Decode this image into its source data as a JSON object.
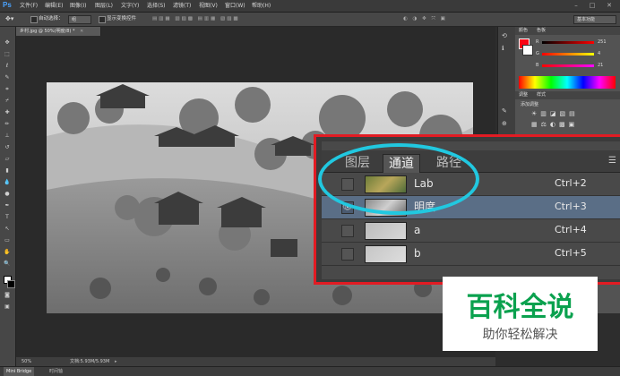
{
  "app": {
    "logo": "Ps"
  },
  "menu": [
    "文件(F)",
    "编辑(E)",
    "图像(I)",
    "图层(L)",
    "文字(Y)",
    "选择(S)",
    "滤镜(T)",
    "视图(V)",
    "窗口(W)",
    "帮助(H)"
  ],
  "options": {
    "auto_select_label": "自动选择：",
    "auto_select_value": "组",
    "show_transform_label": "显示变换控件",
    "workspace": "基本功能"
  },
  "document": {
    "tab_title": "乡村.jpg @ 50%(明度/8) *"
  },
  "status": {
    "zoom": "50%",
    "doc_size": "文档:5.93M/5.93M"
  },
  "bottom_tabs": [
    "Mini Bridge",
    "时间轴"
  ],
  "color_panel": {
    "tabs": [
      "颜色",
      "色板"
    ],
    "channels": [
      {
        "label": "R",
        "value": "251"
      },
      {
        "label": "G",
        "value": "4"
      },
      {
        "label": "B",
        "value": "21"
      }
    ]
  },
  "adjust_panel": {
    "tabs": [
      "调整",
      "样式"
    ],
    "title": "添加调整"
  },
  "channels_panel": {
    "tabs": [
      "图层",
      "通道",
      "路径"
    ],
    "active_tab": 1,
    "rows": [
      {
        "name": "Lab",
        "shortcut": "Ctrl+2",
        "visible": false,
        "selected": false,
        "thumb": "color"
      },
      {
        "name": "明度",
        "shortcut": "Ctrl+3",
        "visible": true,
        "selected": true,
        "thumb": "gray"
      },
      {
        "name": "a",
        "shortcut": "Ctrl+4",
        "visible": false,
        "selected": false,
        "thumb": "light"
      },
      {
        "name": "b",
        "shortcut": "Ctrl+5",
        "visible": false,
        "selected": false,
        "thumb": "light"
      }
    ]
  },
  "watermark": {
    "main": "百科全说",
    "sub": "助你轻松解决"
  },
  "colors": {
    "highlight_border": "#e21b23",
    "annotation_ellipse": "#21c8e0",
    "brand_green": "#0aa14e",
    "selected_row": "#5a6e86"
  }
}
